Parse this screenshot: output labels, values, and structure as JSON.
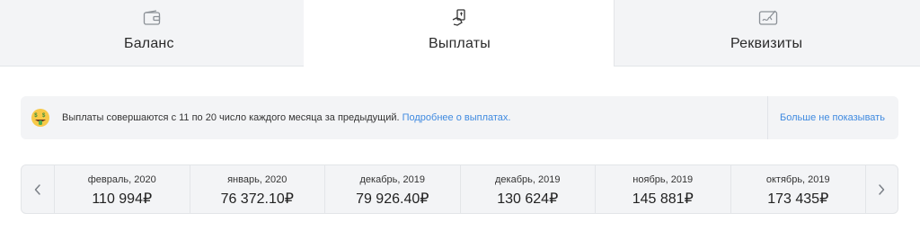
{
  "tabs": [
    {
      "label": "Баланс",
      "icon": "wallet-icon"
    },
    {
      "label": "Выплаты",
      "icon": "hand-money-icon"
    },
    {
      "label": "Реквизиты",
      "icon": "signature-icon"
    }
  ],
  "notice": {
    "emoji": "money-mouth-face-icon",
    "text": "Выплаты совершаются с 11 по 20 число каждого месяца за предыдущий.",
    "link": "Подробнее о выплатах.",
    "dismiss": "Больше не показывать"
  },
  "payouts": [
    {
      "month": "февраль, 2020",
      "amount": "110 994₽"
    },
    {
      "month": "январь, 2020",
      "amount": "76 372.10₽"
    },
    {
      "month": "декабрь, 2019",
      "amount": "79 926.40₽"
    },
    {
      "month": "декабрь, 2019",
      "amount": "130 624₽"
    },
    {
      "month": "ноябрь, 2019",
      "amount": "145 881₽"
    },
    {
      "month": "октябрь, 2019",
      "amount": "173 435₽"
    }
  ],
  "colors": {
    "accent": "#3f8ae0",
    "panel": "#f3f4f6",
    "border": "#e3e5e8"
  }
}
